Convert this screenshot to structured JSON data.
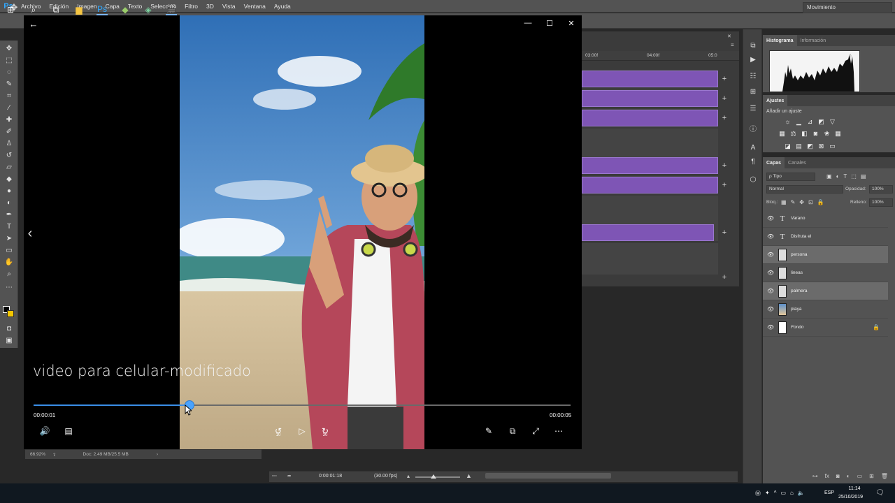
{
  "photoshop": {
    "logo": "Ps",
    "menu": [
      "Archivo",
      "Edición",
      "Imagen",
      "Capa",
      "Texto",
      "Selección",
      "Filtro",
      "3D",
      "Vista",
      "Ventana",
      "Ayuda"
    ],
    "workspace": "Movimiento",
    "doc_status": {
      "zoom": "66.92%",
      "doc": "Doc: 2.49 MB/25.5 MB"
    },
    "timeline": {
      "ruler": [
        "03:00f",
        "04:00f",
        "05:0"
      ],
      "current_time": "0:00:01:18",
      "fps": "(30.00 fps)"
    },
    "panels": {
      "histogram_tabs": [
        "Histograma",
        "Información"
      ],
      "adjust_tab": "Ajustes",
      "adjust_add": "Añadir un ajuste",
      "layers_tabs": [
        "Capas",
        "Canales"
      ],
      "filter_kind": "ρ Tipo",
      "blend_mode": "Normal",
      "opacity_label": "Opacidad:",
      "opacity_value": "100%",
      "lock_label": "Bloq.:",
      "fill_label": "Relleno:",
      "fill_value": "100%"
    },
    "layers": [
      {
        "name": "Varano",
        "kind": "text"
      },
      {
        "name": "Disfruta el",
        "kind": "text"
      },
      {
        "name": "persona",
        "kind": "image",
        "selected": true
      },
      {
        "name": "lineas",
        "kind": "image"
      },
      {
        "name": "palmera",
        "kind": "image",
        "selected": true
      },
      {
        "name": "playa",
        "kind": "sky"
      },
      {
        "name": "Fondo",
        "kind": "white",
        "locked": true
      }
    ]
  },
  "player": {
    "title": "video para celular-modificado",
    "time_current": "00:00:01",
    "time_total": "00:00:05",
    "progress": 0.29,
    "skip_back_seconds": "10",
    "skip_forward_seconds": "30"
  },
  "taskbar": {
    "lang": "ESP",
    "time": "11:14",
    "date": "25/10/2019"
  },
  "colors": {
    "accent": "#3a8ee6",
    "clip": "#7e55b5",
    "ps_panel": "#535353"
  }
}
